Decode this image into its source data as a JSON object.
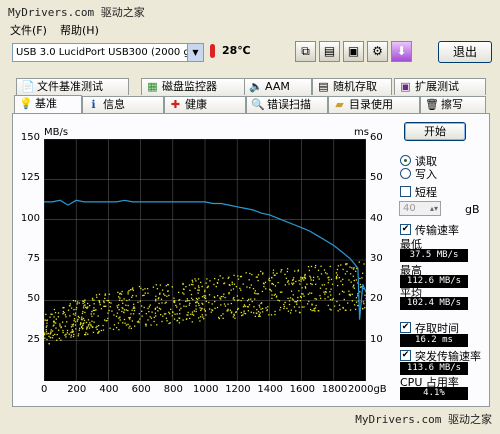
{
  "watermark": {
    "top": "MyDrivers.com 驱动之家",
    "bottom": "MyDrivers.com 驱动之家"
  },
  "menu": {
    "file": "文件(F)",
    "help": "帮助(H)"
  },
  "toolbar": {
    "drive": "USB 3.0 LucidPort USB300 (2000 gB)",
    "temperature": "28℃",
    "exit_label": "退出",
    "icons": [
      "copy-icon",
      "copy-text-icon",
      "save-icon",
      "options-icon",
      "download-icon"
    ]
  },
  "tabs_row1": [
    {
      "label": "文件基准测试",
      "icon": "file-bench-icon"
    },
    {
      "label": "磁盘监控器",
      "icon": "disk-monitor-icon"
    },
    {
      "label": "AAM",
      "icon": "speaker-icon"
    },
    {
      "label": "随机存取",
      "icon": "random-access-icon"
    },
    {
      "label": "扩展测试",
      "icon": "extra-tests-icon"
    }
  ],
  "tabs_row2": [
    {
      "label": "基准",
      "icon": "benchmark-icon"
    },
    {
      "label": "信息",
      "icon": "info-icon"
    },
    {
      "label": "健康",
      "icon": "health-icon"
    },
    {
      "label": "错误扫描",
      "icon": "error-scan-icon"
    },
    {
      "label": "目录使用",
      "icon": "folder-usage-icon"
    },
    {
      "label": "擦写",
      "icon": "erase-icon"
    }
  ],
  "controls": {
    "start_label": "开始",
    "read_label": "读取",
    "write_label": "写入",
    "short_label": "短程",
    "size_value": "40",
    "size_unit": "gB",
    "transfer_rate_label": "传输速率",
    "min_label": "最低",
    "min_value": "37.5 MB/s",
    "max_label": "最高",
    "max_value": "112.6 MB/s",
    "avg_label": "平均",
    "avg_value": "102.4 MB/s",
    "access_time_label": "存取时间",
    "access_time_value": "16.2 ms",
    "burst_label": "突发传输速率",
    "burst_value": "113.6 MB/s",
    "cpu_label": "CPU 占用率",
    "cpu_value": "4.1%"
  },
  "chart_data": {
    "type": "line",
    "left_axis_unit": "MB/s",
    "right_axis_unit": "ms",
    "x_unit": "gB",
    "x_ticks": [
      0,
      200,
      400,
      600,
      800,
      1000,
      1200,
      1400,
      1600,
      1800,
      2000
    ],
    "y_left_ticks": [
      25,
      50,
      75,
      100,
      125,
      150
    ],
    "y_right_ticks": [
      10,
      20,
      30,
      40,
      50,
      60
    ],
    "ylim_left": [
      0,
      150
    ],
    "ylim_right": [
      0,
      60
    ],
    "xlim": [
      0,
      2000
    ],
    "grid": true,
    "series": [
      {
        "kind": "transfer-rate",
        "color": "#2a9ad6",
        "x": [
          0,
          50,
          100,
          150,
          200,
          250,
          300,
          350,
          400,
          450,
          500,
          550,
          600,
          650,
          700,
          750,
          800,
          850,
          900,
          950,
          1000,
          1050,
          1100,
          1150,
          1200,
          1250,
          1300,
          1350,
          1400,
          1450,
          1500,
          1550,
          1600,
          1650,
          1700,
          1750,
          1800,
          1850,
          1900,
          1950,
          1960,
          1980,
          2000
        ],
        "y": [
          111,
          111,
          112,
          109,
          112,
          111,
          111,
          111,
          111,
          111,
          112,
          111,
          111,
          111,
          111,
          111,
          111,
          111,
          111,
          111,
          111,
          110,
          110,
          109,
          108,
          107,
          106,
          104,
          103,
          101,
          99,
          97,
          95,
          93,
          90,
          87,
          84,
          80,
          76,
          70,
          38,
          60,
          55
        ]
      }
    ],
    "access_time_scatter": {
      "color": "#e6e62a",
      "x_range": [
        0,
        2000
      ],
      "ms_start": [
        8,
        16
      ],
      "ms_end": [
        18,
        30
      ]
    }
  }
}
